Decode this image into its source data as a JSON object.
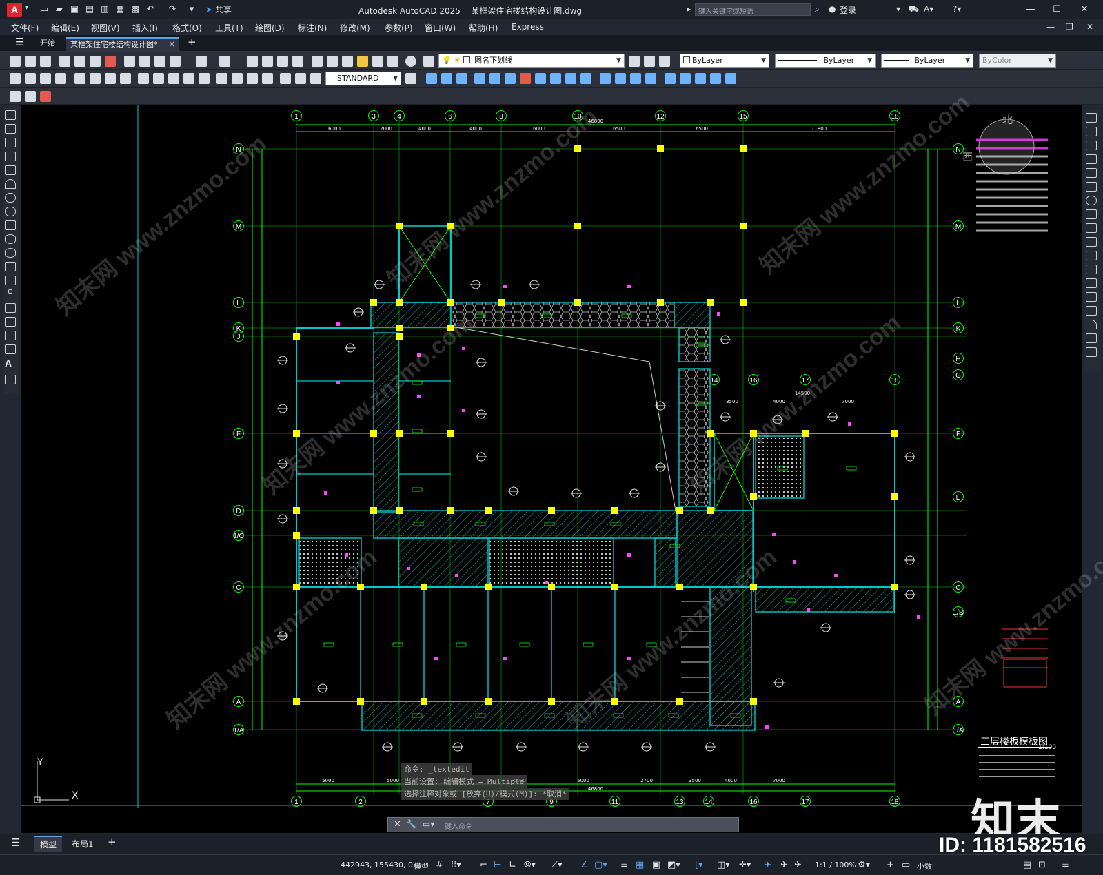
{
  "app": {
    "title": "Autodesk AutoCAD 2025",
    "file": "某框架住宅楼结构设计图.dwg",
    "logo": "A",
    "share": "共享",
    "search_placeholder": "键入关键字或短语",
    "login": "登录"
  },
  "menu": [
    "文件(F)",
    "编辑(E)",
    "视图(V)",
    "插入(I)",
    "格式(O)",
    "工具(T)",
    "绘图(D)",
    "标注(N)",
    "修改(M)",
    "参数(P)",
    "窗口(W)",
    "帮助(H)",
    "Express"
  ],
  "tabs": {
    "start": "开始",
    "active": "某框架住宅楼结构设计图*",
    "add": "+"
  },
  "toolbar": {
    "layer_name": "图名下划线",
    "bylayer_color": "ByLayer",
    "bylayer_linetype": "ByLayer",
    "bylayer_lineweight": "ByLayer",
    "bycolor": "ByColor",
    "dim_style": "STANDARD"
  },
  "drawing": {
    "top_axes": [
      "1",
      "3",
      "4",
      "6",
      "8",
      "10",
      "12",
      "15",
      "18"
    ],
    "bottom_axes": [
      "1",
      "2",
      "7",
      "9",
      "11",
      "13",
      "14",
      "16",
      "17",
      "18"
    ],
    "left_axes": [
      "N",
      "M",
      "L",
      "K",
      "J",
      "F",
      "D",
      "1/C",
      "C",
      "A",
      "1/A"
    ],
    "right_axes": [
      "N",
      "M",
      "L",
      "K",
      "H",
      "G",
      "F",
      "E",
      "C",
      "1/B",
      "A",
      "1/A"
    ],
    "mid_axes": [
      "14",
      "16",
      "17",
      "18"
    ],
    "top_dims": [
      "6000",
      "2000",
      "4000",
      "4000",
      "6000",
      "6500",
      "6500",
      "11800"
    ],
    "top_total": "46800",
    "bottom_dims": [
      "5000",
      "5000",
      "5000",
      "5000",
      "5000",
      "2700",
      "3500",
      "4000",
      "7000"
    ],
    "bottom_total": "46800",
    "mid_dims": [
      "3500",
      "4000",
      "7000"
    ],
    "mid_total": "14500",
    "plan_title": "三层楼板模板图",
    "plan_scale": "1:100",
    "compass_north": "北",
    "compass_west": "西"
  },
  "command": {
    "line1": "命令: _textedit",
    "line2": "当前设置: 编辑模式 = Multiple",
    "line3": "选择注释对象或 [放弃(U)/模式(M)]: *取消*",
    "placeholder": "键入命令"
  },
  "ucs": {
    "x": "X",
    "y": "Y"
  },
  "layouts": {
    "model": "模型",
    "layout1": "布局1",
    "add": "+"
  },
  "status": {
    "coords": "442943, 155430, 0",
    "mode": "模型",
    "scale": "1:1 / 100%",
    "units": "小数"
  },
  "watermark": {
    "site": "知末网 www.znzmo.com",
    "brand": "知末",
    "id": "ID: 1181582516"
  },
  "colors": {
    "accent": "#5fa0e8",
    "grid": "#00ff00",
    "column": "#ffff00",
    "beam": "#00c8c8",
    "dim": "#ff44ff",
    "hatch": "#00b4b4"
  }
}
